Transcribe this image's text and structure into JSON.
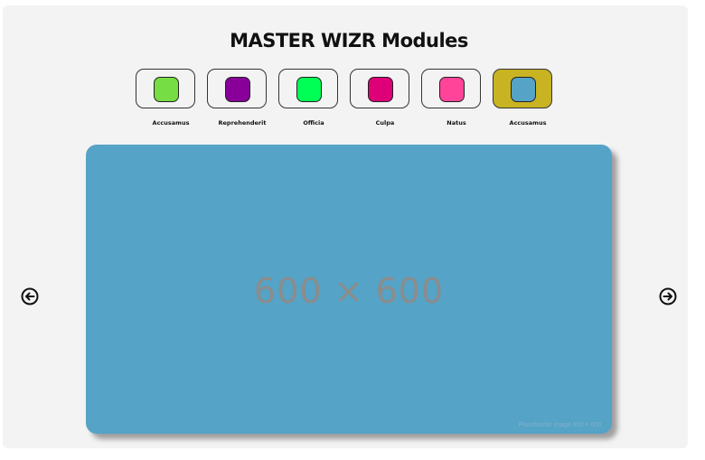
{
  "header": {
    "title": "MASTER WIZR Modules"
  },
  "modules": [
    {
      "label": "Accusamus",
      "color": "#77dd44",
      "active": false
    },
    {
      "label": "Reprehenderit",
      "color": "#880099",
      "active": false
    },
    {
      "label": "Officia",
      "color": "#00ff55",
      "active": false
    },
    {
      "label": "Culpa",
      "color": "#dd0077",
      "active": false
    },
    {
      "label": "Natus",
      "color": "#ff4499",
      "active": false
    },
    {
      "label": "Accusamus",
      "color": "#55a3c6",
      "active": true
    }
  ],
  "slide": {
    "placeholder": "600 × 600",
    "credit": "Placeholder image 600 × 600",
    "color": "#55a3c6"
  },
  "nav": {
    "prev_icon": "arrow-left-circle-icon",
    "next_icon": "arrow-right-circle-icon"
  }
}
